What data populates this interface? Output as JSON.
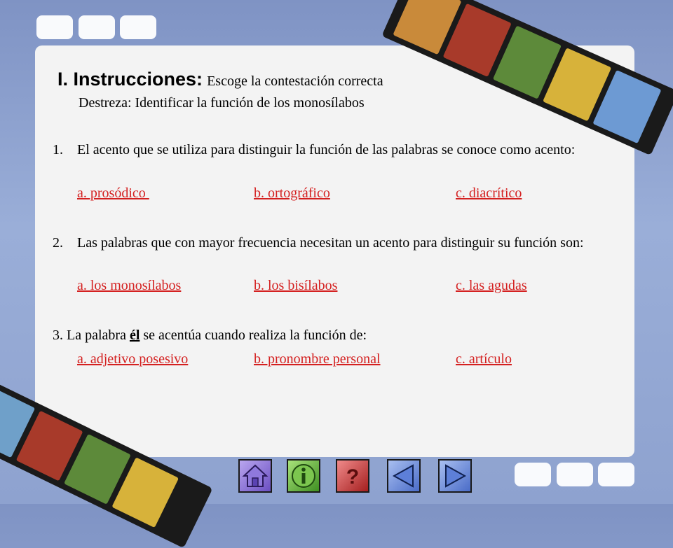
{
  "header": {
    "title": "I. Instrucciones:",
    "subtitle": "Escoge la contestación correcta",
    "skill": "Destreza: Identificar la función de los monosílabos"
  },
  "questions": [
    {
      "number": "1.",
      "text": "El acento que se utiliza para distinguir la función de las palabras se conoce como acento:",
      "options": [
        "a. prosódico ",
        "b. ortográfico",
        "c. diacrítico"
      ]
    },
    {
      "number": "2.",
      "text": "Las palabras que con mayor frecuencia necesitan un acento para distinguir su función son:",
      "options": [
        "a. los monosílabos",
        "b. los bisílabos",
        "c. las agudas"
      ]
    },
    {
      "number": "3.",
      "text_before": "La palabra ",
      "highlight": "él",
      "text_after": " se acentúa cuando realiza la función de:",
      "options": [
        "a. adjetivo posesivo",
        "b. pronombre personal",
        "c. artículo"
      ]
    }
  ],
  "nav": [
    {
      "icon": "home-icon"
    },
    {
      "icon": "info-icon"
    },
    {
      "icon": "help-icon"
    },
    {
      "icon": "back-arrow-icon"
    },
    {
      "icon": "forward-arrow-icon"
    }
  ],
  "colors": {
    "background": "#8ea2cf",
    "panel": "#f3f3f3",
    "link": "#d42020",
    "nav_home": "#8c6fd6",
    "nav_info": "#6dbf3a",
    "nav_help": "#d23b3b",
    "nav_arrow": "#5d7fd8"
  }
}
